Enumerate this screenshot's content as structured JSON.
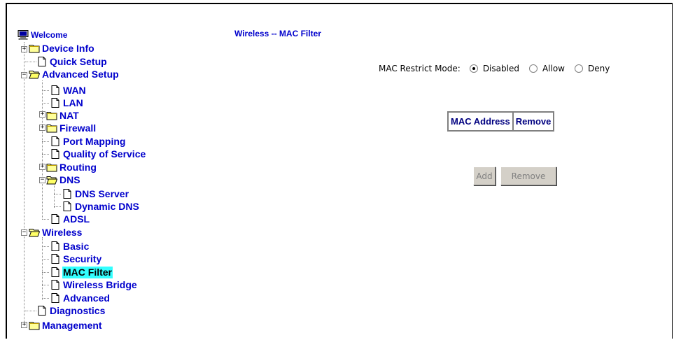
{
  "nav": {
    "welcome": "Welcome",
    "device_info": "Device Info",
    "quick_setup": "Quick Setup",
    "advanced_setup": "Advanced Setup",
    "wan": "WAN",
    "lan": "LAN",
    "nat": "NAT",
    "firewall": "Firewall",
    "port_mapping": "Port Mapping",
    "qos": "Quality of Service",
    "routing": "Routing",
    "dns": "DNS",
    "dns_server": "DNS Server",
    "dynamic_dns": "Dynamic DNS",
    "adsl": "ADSL",
    "wireless": "Wireless",
    "basic": "Basic",
    "security": "Security",
    "mac_filter": "MAC Filter",
    "wireless_bridge": "Wireless Bridge",
    "advanced": "Advanced",
    "diagnostics": "Diagnostics",
    "management": "Management",
    "selected": "MAC Filter"
  },
  "page": {
    "title": "Wireless -- MAC Filter"
  },
  "mode": {
    "label": "MAC Restrict Mode:",
    "options": [
      "Disabled",
      "Allow",
      "Deny"
    ],
    "selected": "Disabled"
  },
  "table": {
    "headers": [
      "MAC Address",
      "Remove"
    ]
  },
  "buttons": {
    "add": "Add",
    "remove": "Remove"
  },
  "colors": {
    "link": "#0000cc",
    "selected_highlight": "#33ffff",
    "table_text": "#000080",
    "button_face": "#d4d0c8"
  },
  "icons": {
    "welcome": "computer-icon",
    "folder_closed": "folder-icon",
    "folder_open": "folder-open-icon",
    "page": "page-icon",
    "expand": "plus-box-icon",
    "collapse": "minus-box-icon"
  }
}
